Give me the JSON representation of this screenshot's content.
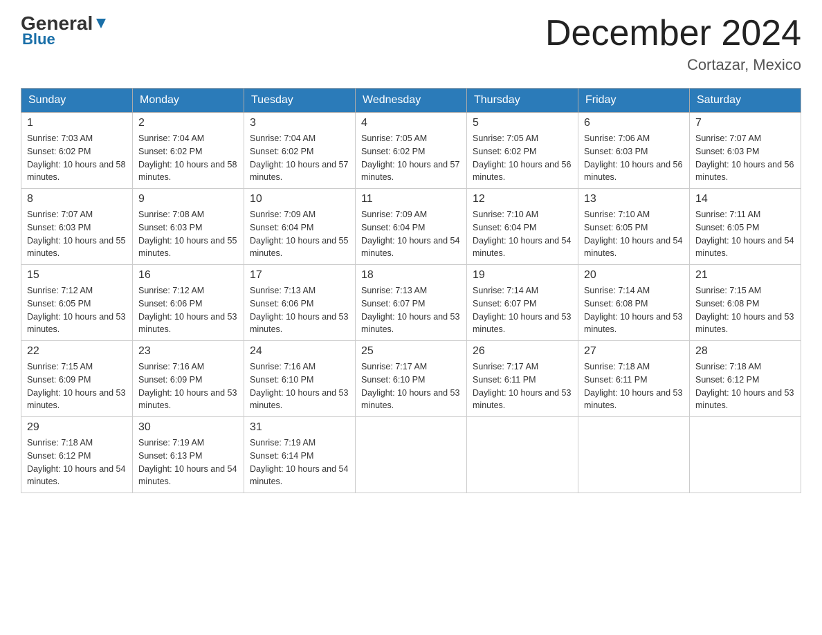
{
  "header": {
    "logo_line1": "General",
    "logo_line2": "Blue",
    "month_title": "December 2024",
    "location": "Cortazar, Mexico"
  },
  "days_of_week": [
    "Sunday",
    "Monday",
    "Tuesday",
    "Wednesday",
    "Thursday",
    "Friday",
    "Saturday"
  ],
  "weeks": [
    [
      {
        "day": "1",
        "sunrise": "7:03 AM",
        "sunset": "6:02 PM",
        "daylight": "10 hours and 58 minutes."
      },
      {
        "day": "2",
        "sunrise": "7:04 AM",
        "sunset": "6:02 PM",
        "daylight": "10 hours and 58 minutes."
      },
      {
        "day": "3",
        "sunrise": "7:04 AM",
        "sunset": "6:02 PM",
        "daylight": "10 hours and 57 minutes."
      },
      {
        "day": "4",
        "sunrise": "7:05 AM",
        "sunset": "6:02 PM",
        "daylight": "10 hours and 57 minutes."
      },
      {
        "day": "5",
        "sunrise": "7:05 AM",
        "sunset": "6:02 PM",
        "daylight": "10 hours and 56 minutes."
      },
      {
        "day": "6",
        "sunrise": "7:06 AM",
        "sunset": "6:03 PM",
        "daylight": "10 hours and 56 minutes."
      },
      {
        "day": "7",
        "sunrise": "7:07 AM",
        "sunset": "6:03 PM",
        "daylight": "10 hours and 56 minutes."
      }
    ],
    [
      {
        "day": "8",
        "sunrise": "7:07 AM",
        "sunset": "6:03 PM",
        "daylight": "10 hours and 55 minutes."
      },
      {
        "day": "9",
        "sunrise": "7:08 AM",
        "sunset": "6:03 PM",
        "daylight": "10 hours and 55 minutes."
      },
      {
        "day": "10",
        "sunrise": "7:09 AM",
        "sunset": "6:04 PM",
        "daylight": "10 hours and 55 minutes."
      },
      {
        "day": "11",
        "sunrise": "7:09 AM",
        "sunset": "6:04 PM",
        "daylight": "10 hours and 54 minutes."
      },
      {
        "day": "12",
        "sunrise": "7:10 AM",
        "sunset": "6:04 PM",
        "daylight": "10 hours and 54 minutes."
      },
      {
        "day": "13",
        "sunrise": "7:10 AM",
        "sunset": "6:05 PM",
        "daylight": "10 hours and 54 minutes."
      },
      {
        "day": "14",
        "sunrise": "7:11 AM",
        "sunset": "6:05 PM",
        "daylight": "10 hours and 54 minutes."
      }
    ],
    [
      {
        "day": "15",
        "sunrise": "7:12 AM",
        "sunset": "6:05 PM",
        "daylight": "10 hours and 53 minutes."
      },
      {
        "day": "16",
        "sunrise": "7:12 AM",
        "sunset": "6:06 PM",
        "daylight": "10 hours and 53 minutes."
      },
      {
        "day": "17",
        "sunrise": "7:13 AM",
        "sunset": "6:06 PM",
        "daylight": "10 hours and 53 minutes."
      },
      {
        "day": "18",
        "sunrise": "7:13 AM",
        "sunset": "6:07 PM",
        "daylight": "10 hours and 53 minutes."
      },
      {
        "day": "19",
        "sunrise": "7:14 AM",
        "sunset": "6:07 PM",
        "daylight": "10 hours and 53 minutes."
      },
      {
        "day": "20",
        "sunrise": "7:14 AM",
        "sunset": "6:08 PM",
        "daylight": "10 hours and 53 minutes."
      },
      {
        "day": "21",
        "sunrise": "7:15 AM",
        "sunset": "6:08 PM",
        "daylight": "10 hours and 53 minutes."
      }
    ],
    [
      {
        "day": "22",
        "sunrise": "7:15 AM",
        "sunset": "6:09 PM",
        "daylight": "10 hours and 53 minutes."
      },
      {
        "day": "23",
        "sunrise": "7:16 AM",
        "sunset": "6:09 PM",
        "daylight": "10 hours and 53 minutes."
      },
      {
        "day": "24",
        "sunrise": "7:16 AM",
        "sunset": "6:10 PM",
        "daylight": "10 hours and 53 minutes."
      },
      {
        "day": "25",
        "sunrise": "7:17 AM",
        "sunset": "6:10 PM",
        "daylight": "10 hours and 53 minutes."
      },
      {
        "day": "26",
        "sunrise": "7:17 AM",
        "sunset": "6:11 PM",
        "daylight": "10 hours and 53 minutes."
      },
      {
        "day": "27",
        "sunrise": "7:18 AM",
        "sunset": "6:11 PM",
        "daylight": "10 hours and 53 minutes."
      },
      {
        "day": "28",
        "sunrise": "7:18 AM",
        "sunset": "6:12 PM",
        "daylight": "10 hours and 53 minutes."
      }
    ],
    [
      {
        "day": "29",
        "sunrise": "7:18 AM",
        "sunset": "6:12 PM",
        "daylight": "10 hours and 54 minutes."
      },
      {
        "day": "30",
        "sunrise": "7:19 AM",
        "sunset": "6:13 PM",
        "daylight": "10 hours and 54 minutes."
      },
      {
        "day": "31",
        "sunrise": "7:19 AM",
        "sunset": "6:14 PM",
        "daylight": "10 hours and 54 minutes."
      },
      null,
      null,
      null,
      null
    ]
  ]
}
